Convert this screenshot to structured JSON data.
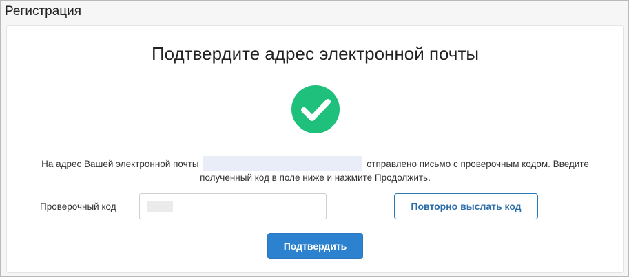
{
  "window": {
    "title": "Регистрация"
  },
  "card": {
    "heading": "Подтвердите адрес электронной почты",
    "status_icon": "check-circle-icon",
    "status_color": "#1ec07c",
    "message_before_email": "На адрес Вашей электронной почты",
    "message_after_email": "отправлено письмо с проверочным кодом. Введите",
    "message_line2": "полученный код в поле ниже и нажмите Продолжить."
  },
  "form": {
    "code_label": "Проверочный код",
    "code_value": "",
    "resend_label": "Повторно выслать код",
    "confirm_label": "Подтвердить"
  },
  "colors": {
    "primary": "#2d82d0",
    "outline": "#2b7bb9"
  }
}
